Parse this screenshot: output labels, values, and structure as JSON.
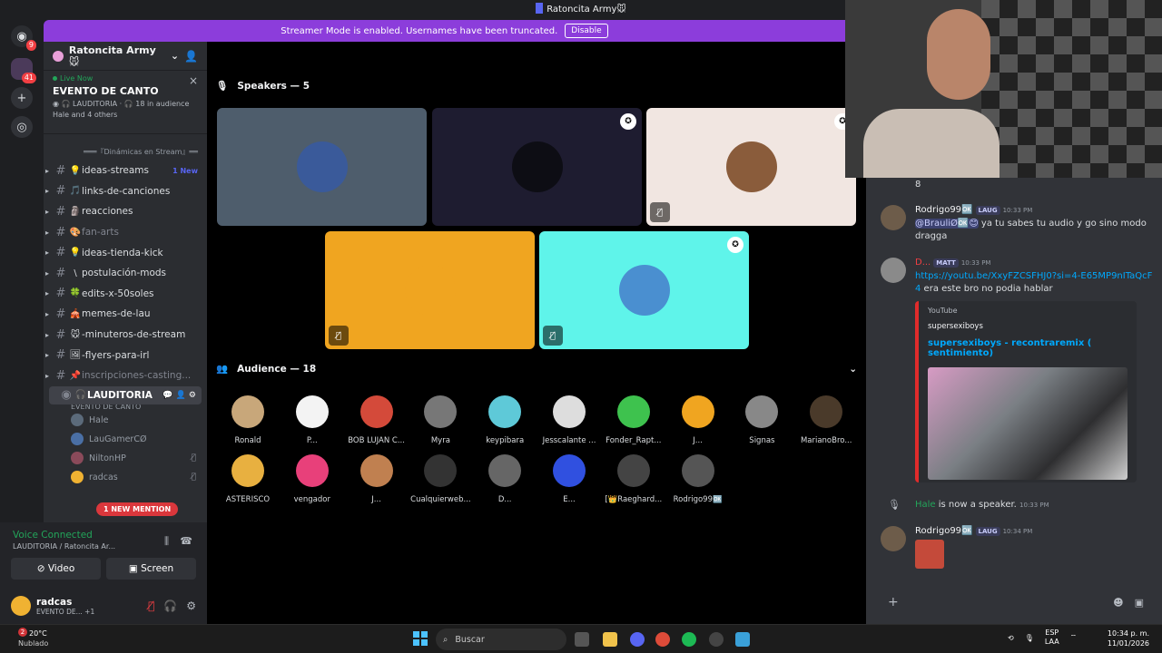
{
  "titlebar": {
    "title": "Ratoncita Army🐭"
  },
  "banner": {
    "text": "Streamer Mode is enabled. Usernames have been truncated.",
    "button": "Disable"
  },
  "servers": {
    "dm_badge": "9",
    "server_badge": "41"
  },
  "server": {
    "name": "Ratoncita Army🐭"
  },
  "live": {
    "status": "Live Now",
    "event": "EVENTO DE CANTO",
    "channel": "LAUDITORIA",
    "audience": "18 in audience",
    "participants": "Hale and 4 others"
  },
  "category": "═══『Dinámicas en Stream』══",
  "channels": [
    {
      "emoji": "💡",
      "name": "ideas-streams",
      "new": "1 New",
      "muted": false
    },
    {
      "emoji": "🎵",
      "name": "links-de-canciones",
      "new": "",
      "muted": false
    },
    {
      "emoji": "🗿",
      "name": "reacciones",
      "new": "",
      "muted": false
    },
    {
      "emoji": "🎨",
      "name": "fan-arts",
      "new": "",
      "muted": true
    },
    {
      "emoji": "💡",
      "name": "ideas-tienda-kick",
      "new": "",
      "muted": false
    },
    {
      "emoji": "\\",
      "name": "postulación-mods",
      "new": "",
      "muted": false
    },
    {
      "emoji": "🍀",
      "name": "edits-x-50soles",
      "new": "",
      "muted": false
    },
    {
      "emoji": "🎪",
      "name": "memes-de-lau",
      "new": "",
      "muted": false
    },
    {
      "emoji": "🐭",
      "name": "-minuteros-de-stream",
      "new": "",
      "muted": false
    },
    {
      "emoji": "🖼",
      "name": "-flyers-para-irl",
      "new": "",
      "muted": false
    },
    {
      "emoji": "📌",
      "name": "inscripciones-casting...",
      "new": "",
      "muted": true
    }
  ],
  "voice_channel": {
    "name": "LAUDITORIA",
    "subtitle": "EVENTO DE CANTO",
    "members": [
      "Hale",
      "LauGamerCØ",
      "NiltonHP",
      "radcas"
    ]
  },
  "mention_pill": "1 NEW MENTION",
  "voice_panel": {
    "status": "Voice Connected",
    "location": "LAUDITORIA / Ratoncita Ar...",
    "video": "Video",
    "screen": "Screen"
  },
  "user": {
    "name": "radcas",
    "status": "EVENTO DE...",
    "extra": "+1"
  },
  "stage": {
    "speakers_heading": "Speakers — 5",
    "audience_heading": "Audience — 18",
    "audience": [
      "Ronald",
      "P...",
      "BOB LUJAN C...",
      "Myra",
      "keypibara",
      "Jesscalante ...",
      "Fonder_Rapt...",
      "J...",
      "Signas",
      "MarianoBro...",
      "ASTERISCO",
      "vengador",
      "J...",
      "Cualquierweb...",
      "D...",
      "E...",
      "[👑Raeghard...",
      "Rodrigo99🆗"
    ]
  },
  "chat": {
    "prev_text": "8",
    "m1": {
      "author": "Rodrigo99🆗",
      "tag": "LAUG",
      "time": "10:33 PM",
      "mention": "@BrauliØ🆗😊",
      "text": " ya tu sabes tu audio y go sino modo dragga"
    },
    "m2": {
      "author": "D...",
      "tag": "MATT",
      "time": "10:33 PM",
      "link": "https://youtu.be/XxyFZCSFHJ0?si=4-E65MP9nITaQcF4",
      "text": " era este bro no podia hablar"
    },
    "embed": {
      "provider": "YouTube",
      "author": "supersexiboys",
      "title": "supersexiboys - recontraremix ( sentimiento)"
    },
    "system": {
      "user": "Hale",
      "text": " is now a speaker.",
      "time": "10:33 PM"
    },
    "m3": {
      "author": "Rodrigo99🆗",
      "tag": "LAUG",
      "time": "10:34 PM"
    }
  },
  "taskbar": {
    "temp": "20°C",
    "weather": "Nublado",
    "weather_badge": "2",
    "search": "Buscar",
    "lang1": "ESP",
    "lang2": "LAA",
    "time": "10:34 p. m.",
    "date": "11/01/2026"
  },
  "colors": {
    "accent": "#5865f2",
    "banner": "#8c3ddb",
    "online": "#23a55a",
    "danger": "#f23f43"
  }
}
